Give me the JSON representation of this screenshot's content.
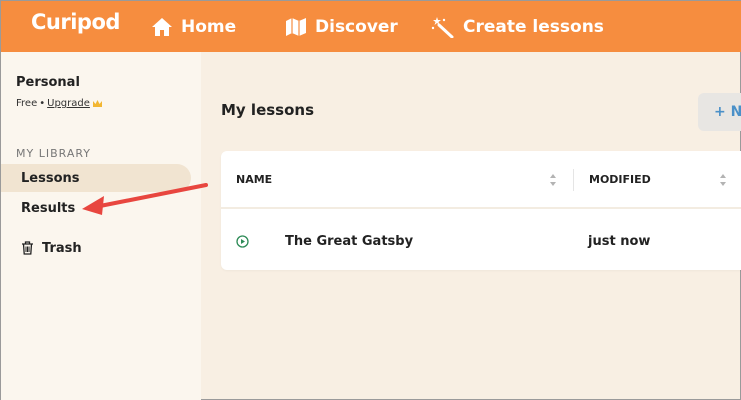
{
  "app": {
    "logo": "Curipod"
  },
  "nav": {
    "items": [
      {
        "label": "Home",
        "icon": "home-icon"
      },
      {
        "label": "Discover",
        "icon": "map-icon"
      },
      {
        "label": "Create lessons",
        "icon": "magic-wand-icon"
      }
    ]
  },
  "sidebar": {
    "org": "Personal",
    "plan": "Free",
    "plan_separator": "•",
    "upgrade": "Upgrade",
    "section": "MY LIBRARY",
    "items": [
      {
        "label": "Lessons",
        "active": true
      },
      {
        "label": "Results"
      },
      {
        "label": "Trash",
        "icon": "trash-icon"
      }
    ]
  },
  "main": {
    "title": "My lessons",
    "new_button": "+ N",
    "table": {
      "columns": [
        "NAME",
        "MODIFIED"
      ],
      "rows": [
        {
          "name": "The Great Gatsby",
          "modified": "just now",
          "icon": "play-icon"
        }
      ]
    }
  },
  "colors": {
    "topbar": "#f68d3f",
    "background": "#f8efe3",
    "sidebar": "#fbf6ee",
    "active_item": "#f1e4d1",
    "arrow": "#e8463f",
    "play_icon": "#2e8b57",
    "new_button_text": "#4a90c8"
  },
  "annotation": {
    "type": "arrow",
    "points_to": "Results"
  }
}
